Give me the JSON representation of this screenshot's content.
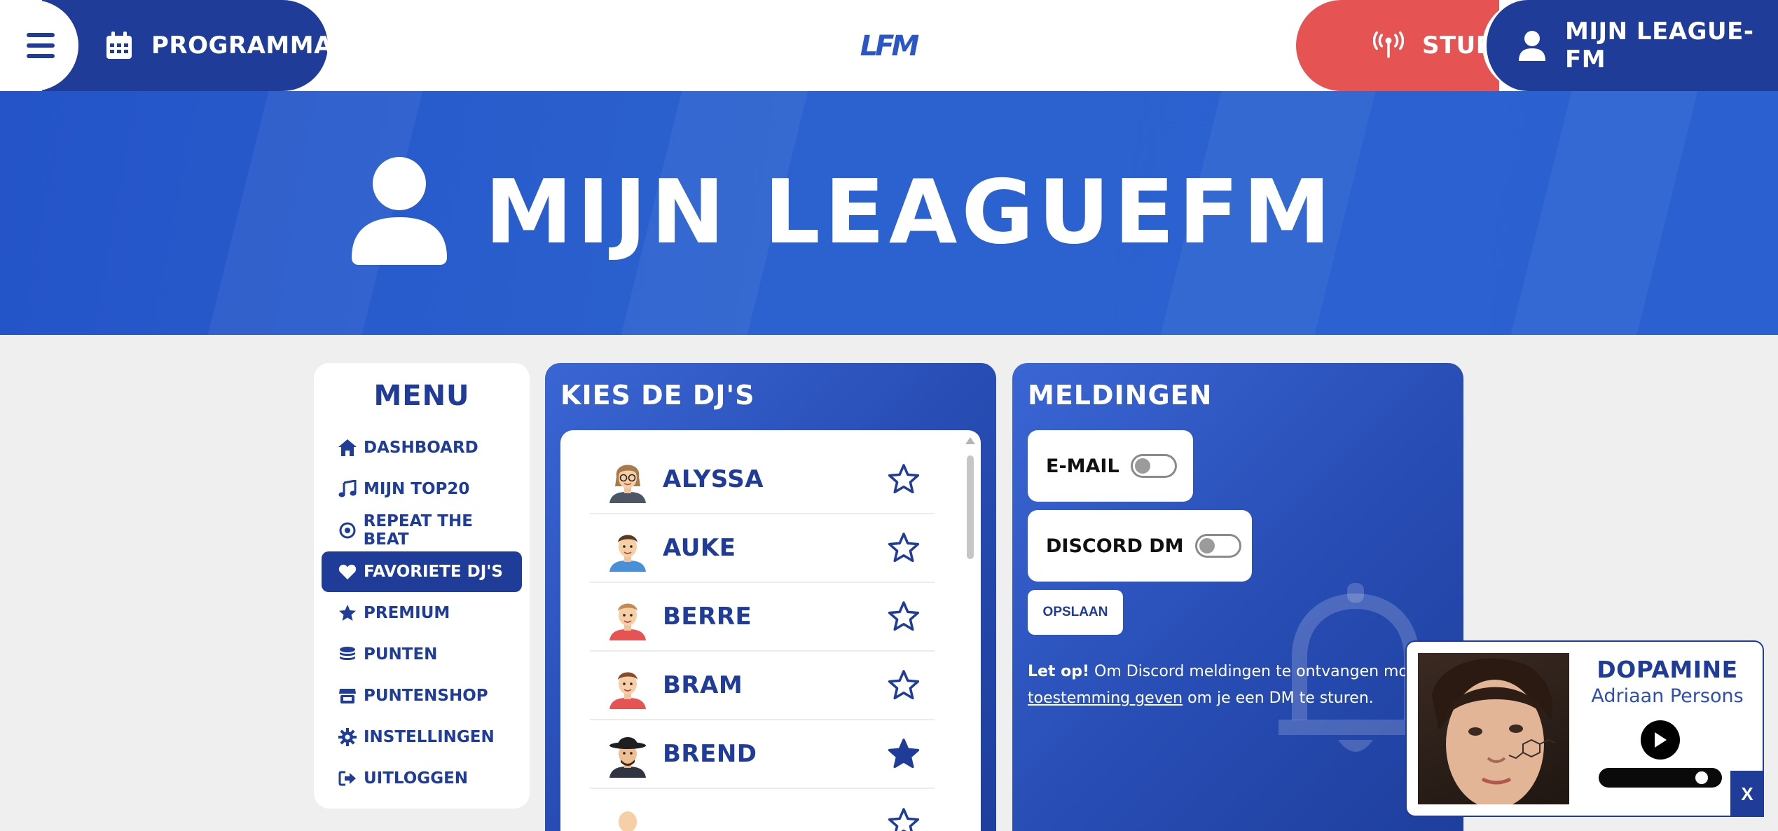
{
  "nav": {
    "programma_label": "PROGRAMMA",
    "logo_text": "LFM",
    "studio_label": "STUDIO",
    "account_label": "MIJN LEAGUE-FM"
  },
  "hero": {
    "title": "MIJN LEAGUEFM"
  },
  "menu": {
    "title": "MENU",
    "items": [
      {
        "label": "DASHBOARD",
        "icon": "home-icon"
      },
      {
        "label": "MIJN TOP20",
        "icon": "music-note-icon"
      },
      {
        "label": "REPEAT THE BEAT",
        "icon": "record-icon"
      },
      {
        "label": "FAVORIETE DJ'S",
        "icon": "heart-icon",
        "active": true
      },
      {
        "label": "PREMIUM",
        "icon": "star-icon"
      },
      {
        "label": "PUNTEN",
        "icon": "coins-icon"
      },
      {
        "label": "PUNTENSHOP",
        "icon": "shop-icon"
      },
      {
        "label": "INSTELLINGEN",
        "icon": "gear-icon"
      },
      {
        "label": "UITLOGGEN",
        "icon": "logout-icon"
      }
    ]
  },
  "djs": {
    "title": "KIES DE DJ'S",
    "list": [
      {
        "name": "ALYSSA",
        "favorite": false
      },
      {
        "name": "AUKE",
        "favorite": false
      },
      {
        "name": "BERRE",
        "favorite": false
      },
      {
        "name": "BRAM",
        "favorite": false
      },
      {
        "name": "BREND",
        "favorite": true
      }
    ]
  },
  "notifications": {
    "title": "MELDINGEN",
    "email_label": "E-MAIL",
    "email_enabled": false,
    "discord_label": "DISCORD DM",
    "discord_enabled": false,
    "save_label": "OPSLAAN",
    "note_bold": "Let op!",
    "note_text": " Om Discord meldingen te ontvangen moet je de l",
    "note_link": "toestemming geven",
    "note_text2": " om je een DM te sturen."
  },
  "player": {
    "title": "DOPAMINE",
    "artist": "Adriaan Persons",
    "progress": 0.92,
    "close_label": "X"
  },
  "colors": {
    "primary": "#1f3c99",
    "studio": "#e65353",
    "hero": "#2a5cce",
    "background": "#efefef"
  }
}
